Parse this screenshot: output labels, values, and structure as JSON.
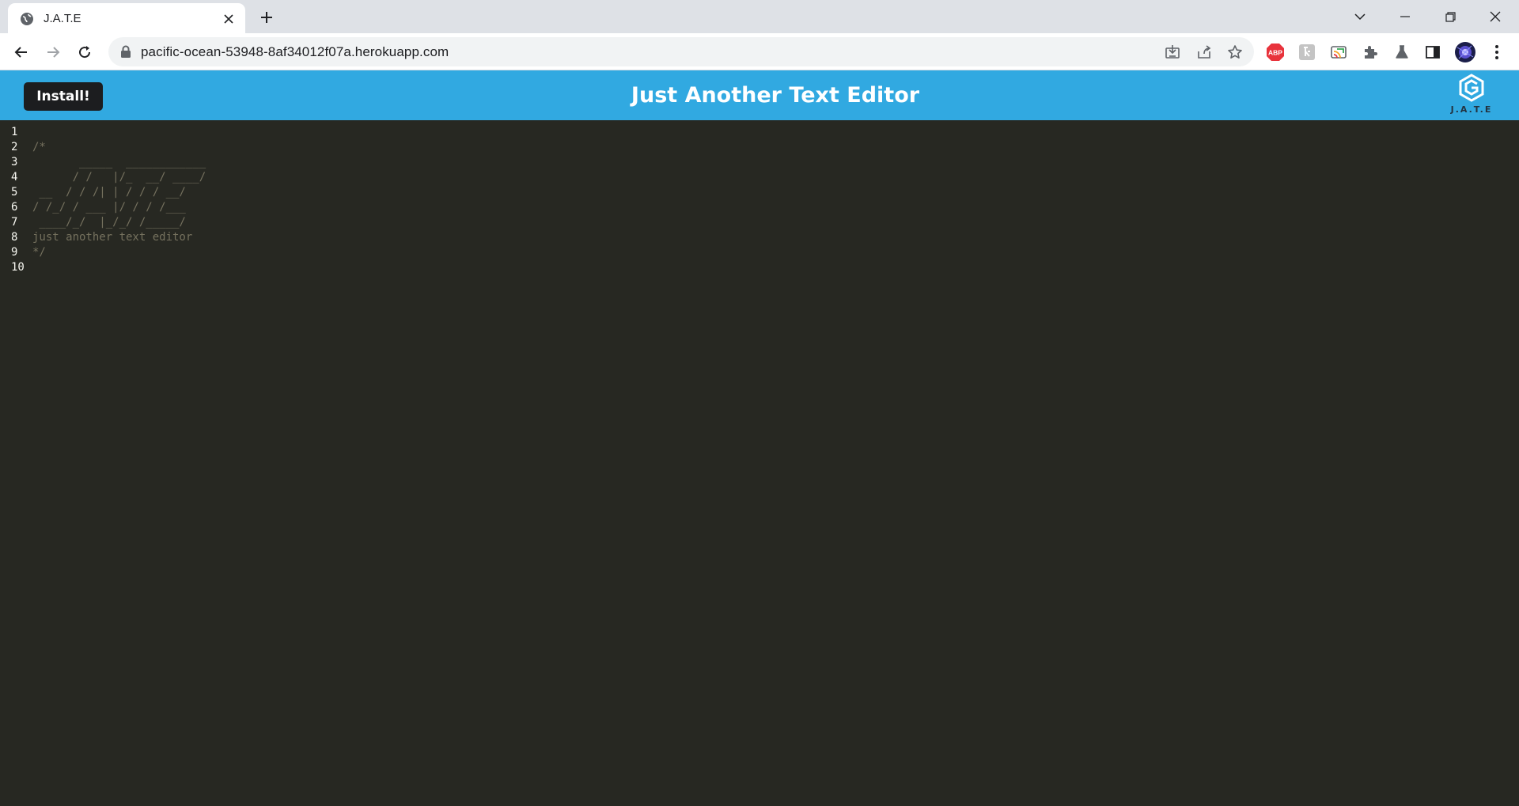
{
  "browser": {
    "tab_title": "J.A.T.E",
    "url": "pacific-ocean-53948-8af34012f07a.herokuapp.com",
    "extensions": [
      "ABP"
    ]
  },
  "app": {
    "install_label": "Install!",
    "title": "Just Another Text Editor",
    "logo_text": "J.A.T.E"
  },
  "editor": {
    "lines": [
      {
        "num": "1",
        "text": ""
      },
      {
        "num": "2",
        "text": "/*"
      },
      {
        "num": "3",
        "text": "       _____  ____________"
      },
      {
        "num": "4",
        "text": "      / /   |/_  __/ ____/"
      },
      {
        "num": "5",
        "text": " __  / / /| | / / / __/"
      },
      {
        "num": "6",
        "text": "/ /_/ / ___ |/ / / /___"
      },
      {
        "num": "7",
        "text": " ____/_/  |_/_/ /_____/"
      },
      {
        "num": "8",
        "text": "just another text editor"
      },
      {
        "num": "9",
        "text": "*/"
      },
      {
        "num": "10",
        "text": ""
      }
    ]
  },
  "colors": {
    "header": "#31a9e1",
    "editor_bg": "#272822",
    "comment": "#75715e",
    "gutter_text": "#f8f8f2",
    "install_bg": "#1c1d1f"
  }
}
